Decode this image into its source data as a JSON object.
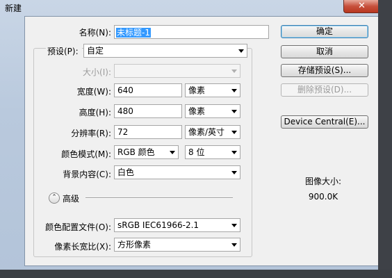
{
  "window": {
    "title": "新建",
    "close_label": "✕"
  },
  "form": {
    "name_label": "名称(N):",
    "name_value": "未标题-1",
    "preset_label": "预设(P):",
    "preset_value": "自定",
    "size_label": "大小(I):",
    "size_value": "",
    "width_label": "宽度(W):",
    "width_value": "640",
    "width_unit": "像素",
    "height_label": "高度(H):",
    "height_value": "480",
    "height_unit": "像素",
    "resolution_label": "分辨率(R):",
    "resolution_value": "72",
    "resolution_unit": "像素/英寸",
    "color_mode_label": "颜色模式(M):",
    "color_mode_value": "RGB 颜色",
    "bit_depth_value": "8 位",
    "background_label": "背景内容(C):",
    "background_value": "白色",
    "advanced_label": "高级",
    "advanced_icon": "chevron-up-double-icon",
    "color_profile_label": "颜色配置文件(O):",
    "color_profile_value": "sRGB IEC61966-2.1",
    "pixel_aspect_label": "像素长宽比(X):",
    "pixel_aspect_value": "方形像素"
  },
  "buttons": {
    "ok": "确定",
    "cancel": "取消",
    "save_preset": "存储预设(S)...",
    "delete_preset": "删除预设(D)...",
    "device_central": "Device Central(E)..."
  },
  "image_size": {
    "label": "图像大小:",
    "value": "900.0K"
  },
  "colors": {
    "selection": "#3399ff",
    "close_button": "#c7503c",
    "dialog_bg": "#f0f0f0"
  }
}
